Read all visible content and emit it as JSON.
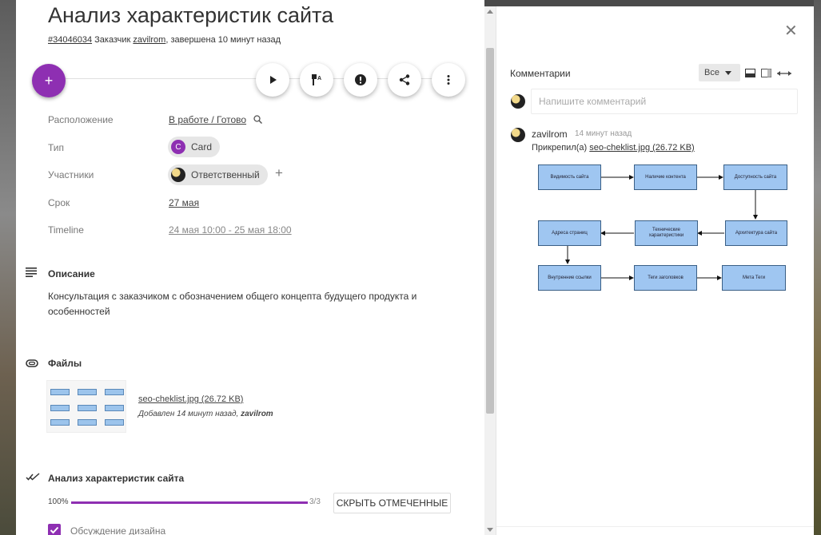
{
  "task": {
    "title": "Анализ характеристик сайта",
    "id": "#34046034",
    "client_label": "Заказчик",
    "client": "zavilrom",
    "status": ", завершена 10 минут назад"
  },
  "actions": {
    "add": "+",
    "icons": [
      "play-icon",
      "flag-icon",
      "alert-icon",
      "share-icon",
      "more-vert-icon"
    ]
  },
  "properties": {
    "location_label": "Расположение",
    "location_value": "В работе / Готово",
    "type_label": "Тип",
    "type_initial": "C",
    "type_value": "Card",
    "members_label": "Участники",
    "member_value": "Ответственный",
    "add_member": "+",
    "due_label": "Срок",
    "due_value": "27 мая",
    "timeline_label": "Timeline",
    "timeline_value": "24 мая 10:00 - 25 мая 18:00"
  },
  "description": {
    "title": "Описание",
    "text": "Консультация с заказчиком с обозначением общего концепта будущего продукта и особенностей"
  },
  "files": {
    "title": "Файлы",
    "file_name": "seo-cheklist.jpg (26.72 KB)",
    "file_meta_prefix": "Добавлен 14 минут назад, ",
    "file_meta_author": "zavilrom"
  },
  "checklist": {
    "title": "Анализ характеристик сайта",
    "percent_label": "100%",
    "progress": 1.0,
    "count": "3/3",
    "hide_button": "СКРЫТЬ ОТМЕЧЕННЫЕ",
    "item_label": "Обсуждение дизайна"
  },
  "comments": {
    "title": "Комментарии",
    "filter_value": "Все",
    "input_placeholder": "Напишите комментарий",
    "author": "zavilrom",
    "time": "14 минут назад",
    "attach_prefix": "Прикрепил(а) ",
    "attach_file": "seo-cheklist.jpg (26.72 KB)"
  },
  "flowchart": {
    "boxes": [
      "Видимость сайта",
      "Наличие контента",
      "Доступность сайта",
      "Адреса страниц",
      "Технические характеристики",
      "Архитектура сайта",
      "Внутренние ссылки",
      "Теги заголовков",
      "Мета Теги"
    ]
  }
}
